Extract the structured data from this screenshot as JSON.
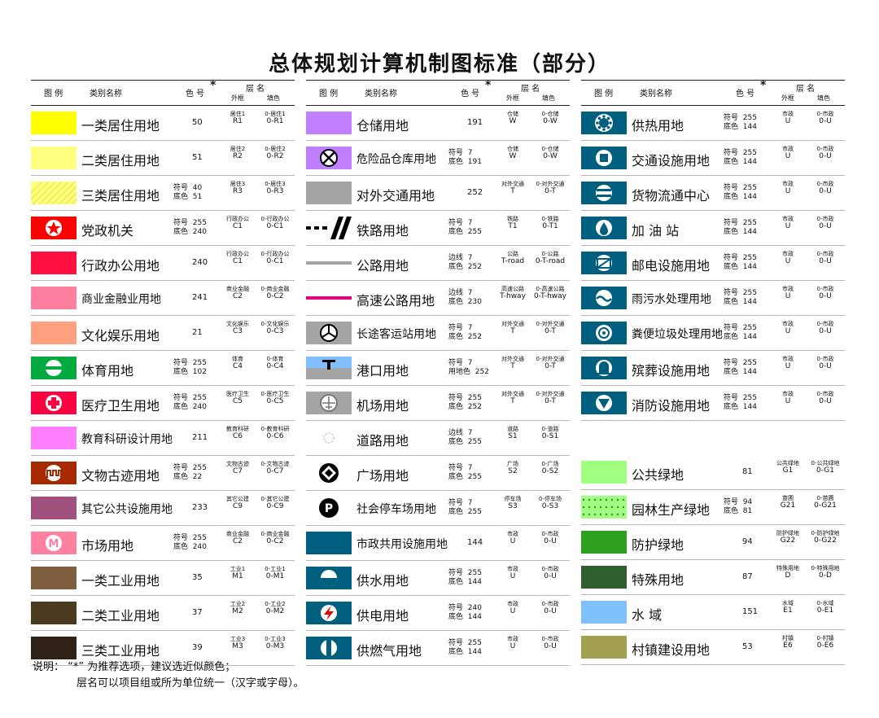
{
  "title": "总体规划计算机制图标准（部分）",
  "header": {
    "legend": "图 例",
    "name": "类别名称",
    "code": "色 号",
    "star": "*",
    "layer": "层 名",
    "outer": "外框",
    "fill": "填色"
  },
  "note": {
    "line1": "说明：  “*” 为推荐选项，建议选近似颜色；",
    "line2": "层名可以项目组或所为单位统一（汉字或字母）。"
  },
  "columns": [
    {
      "rows": [
        {
          "name": "一类居住用地",
          "icon": "yellow-swatch",
          "color": "#ffff00",
          "code_single": "50",
          "outer_cn": "居住1",
          "outer_code": "R1",
          "fill_cn": "0-居住1",
          "fill_code": "0-R1"
        },
        {
          "name": "二类居住用地",
          "icon": "light-yellow-swatch",
          "color": "#ffff80",
          "code_single": "51",
          "outer_cn": "居住2",
          "outer_code": "R2",
          "fill_cn": "0-居住2",
          "fill_code": "0-R2"
        },
        {
          "name": "三类居住用地",
          "icon": "hatched-yellow-swatch",
          "color": "#ffff80",
          "sym_label": "符号",
          "sym_val": "40",
          "base_label": "底色",
          "base_val": "51",
          "outer_cn": "居住3",
          "outer_code": "R3",
          "fill_cn": "0-居住3",
          "fill_code": "0-R3"
        },
        {
          "name": "党政机关",
          "icon": "star-circle-icon",
          "color": "#ff0000",
          "sym_label": "符号",
          "sym_val": "255",
          "base_label": "底色",
          "base_val": "240",
          "outer_cn": "行政办公",
          "outer_code": "C1",
          "fill_cn": "0-行政办公",
          "fill_code": "0-C1"
        },
        {
          "name": "行政办公用地",
          "icon": "red-swatch",
          "color": "#ff1040",
          "code_single": "240",
          "outer_cn": "行政办公",
          "outer_code": "C1",
          "fill_cn": "0-行政办公",
          "fill_code": "0-C1"
        },
        {
          "name": "商业金融业用地",
          "icon": "pink-swatch",
          "color": "#ff7fa0",
          "code_single": "241",
          "outer_cn": "商业金融",
          "outer_code": "C2",
          "fill_cn": "0-商业金融",
          "fill_code": "0-C2"
        },
        {
          "name": "文化娱乐用地",
          "icon": "salmon-swatch",
          "color": "#ffa07f",
          "code_single": "21",
          "outer_cn": "文化娱乐",
          "outer_code": "C3",
          "fill_cn": "0-文化娱乐",
          "fill_code": "0-C3"
        },
        {
          "name": "体育用地",
          "icon": "sports-circle-icon",
          "color": "#00aa3f",
          "sym_label": "符号",
          "sym_val": "255",
          "base_label": "底色",
          "base_val": "102",
          "outer_cn": "体育",
          "outer_code": "C4",
          "fill_cn": "0-体育",
          "fill_code": "0-C4"
        },
        {
          "name": "医疗卫生用地",
          "icon": "medical-cross-icon",
          "color": "#ff0040",
          "sym_label": "符号",
          "sym_val": "255",
          "base_label": "底色",
          "base_val": "240",
          "outer_cn": "医疗卫生",
          "outer_code": "C5",
          "fill_cn": "0-医疗卫生",
          "fill_code": "0-C5"
        },
        {
          "name": "教育科研设计用地",
          "icon": "violet-swatch",
          "color": "#ff80ff",
          "code_single": "211",
          "outer_cn": "教育科研",
          "outer_code": "C6",
          "fill_cn": "0-教育科研",
          "fill_code": "0-C6"
        },
        {
          "name": "文物古迹用地",
          "icon": "heritage-icon",
          "color": "#a52a00",
          "sym_label": "符号",
          "sym_val": "255",
          "base_label": "底色",
          "base_val": "22",
          "outer_cn": "文物古迹",
          "outer_code": "C7",
          "fill_cn": "0-文物古迹",
          "fill_code": "0-C7"
        },
        {
          "name": "其它公共设施用地",
          "icon": "mauve-swatch",
          "color": "#a0507f",
          "code_single": "233",
          "outer_cn": "其它公建",
          "outer_code": "C9",
          "fill_cn": "0-其它公建",
          "fill_code": "0-C9"
        },
        {
          "name": "市场用地",
          "icon": "market-m-icon",
          "color": "#ff80a0",
          "sym_label": "符号",
          "sym_val": "255",
          "base_label": "底色",
          "base_val": "240",
          "outer_cn": "商业金融",
          "outer_code": "C2",
          "fill_cn": "0-商业金融",
          "fill_code": "0-C2"
        },
        {
          "name": "一类工业用地",
          "icon": "brown-swatch",
          "color": "#7f5f3f",
          "code_single": "35",
          "outer_cn": "工业1",
          "outer_code": "M1",
          "fill_cn": "0-工业1",
          "fill_code": "0-M1"
        },
        {
          "name": "二类工业用地",
          "icon": "dark-brown-swatch",
          "color": "#4c3a20",
          "code_single": "37",
          "outer_cn": "工业2",
          "outer_code": "M2",
          "fill_cn": "0-工业2",
          "fill_code": "0-M2"
        },
        {
          "name": "三类工业用地",
          "icon": "darkest-brown-swatch",
          "color": "#2e2218",
          "code_single": "39",
          "outer_cn": "工业3",
          "outer_code": "M3",
          "fill_cn": "0-工业3",
          "fill_code": "0-M3"
        }
      ]
    },
    {
      "rows": [
        {
          "name": "仓储用地",
          "icon": "purple-swatch",
          "color": "#bf7fff",
          "code_single": "191",
          "outer_cn": "仓储",
          "outer_code": "W",
          "fill_cn": "0-仓储",
          "fill_code": "0-W"
        },
        {
          "name": "危险品仓库用地",
          "icon": "hazard-x-icon",
          "color": "#bf7fff",
          "sym_label": "符号",
          "sym_val": "7",
          "base_label": "底色",
          "base_val": "191",
          "outer_cn": "仓储",
          "outer_code": "W",
          "fill_cn": "0-仓储",
          "fill_code": "0-W"
        },
        {
          "name": "对外交通用地",
          "icon": "gray-swatch",
          "color": "#a5a5a5",
          "code_single": "252",
          "outer_cn": "对外交通",
          "outer_code": "T",
          "fill_cn": "0-对外交通",
          "fill_code": "0-T"
        },
        {
          "name": "铁路用地",
          "icon": "railway-icon",
          "color": "#000000",
          "sym_label": "符号",
          "sym_val": "7",
          "base_label": "底色",
          "base_val": "255",
          "outer_cn": "铁路",
          "outer_code": "T1",
          "fill_cn": "0-铁路",
          "fill_code": "0-T1"
        },
        {
          "name": "公路用地",
          "icon": "road-line-icon",
          "color": "#a5a5a5",
          "sym_label": "边线",
          "sym_val": "7",
          "base_label": "底色",
          "base_val": "252",
          "outer_cn": "公路",
          "outer_code": "T-road",
          "fill_cn": "0-公路",
          "fill_code": "0-T-road"
        },
        {
          "name": "高速公路用地",
          "icon": "highway-line-icon",
          "color": "#e0007f",
          "sym_label": "边线",
          "sym_val": "7",
          "base_label": "底色",
          "base_val": "230",
          "outer_cn": "高速公路",
          "outer_code": "T-hway",
          "fill_cn": "0-高速公路",
          "fill_code": "0-T-hway"
        },
        {
          "name": "长途客运站用地",
          "icon": "bus-station-icon",
          "color": "#a5a5a5",
          "sym_label": "符号",
          "sym_val": "7",
          "base_label": "底色",
          "base_val": "252",
          "outer_cn": "对外交通",
          "outer_code": "T",
          "fill_cn": "0-对外交通",
          "fill_code": "0-T"
        },
        {
          "name": "港口用地",
          "icon": "port-anchor-icon",
          "color": "#7fbfff",
          "sym_label": "符号",
          "sym_val": "7",
          "base_label": "用地色",
          "base_val": "252",
          "outer_cn": "对外交通",
          "outer_code": "T",
          "fill_cn": "0-对外交通",
          "fill_code": "0-T"
        },
        {
          "name": "机场用地",
          "icon": "airport-icon",
          "color": "#a5a5a5",
          "sym_label": "符号",
          "sym_val": "255",
          "base_label": "底色",
          "base_val": "252",
          "outer_cn": "对外交通",
          "outer_code": "T",
          "fill_cn": "0-对外交通",
          "fill_code": "0-T"
        },
        {
          "name": "道路用地",
          "icon": "road-dots-icon",
          "color": "#ffffff",
          "sym_label": "边线",
          "sym_val": "7",
          "base_label": "底色",
          "base_val": "255",
          "outer_cn": "道路",
          "outer_code": "S1",
          "fill_cn": "0-道路",
          "fill_code": "0-S1"
        },
        {
          "name": "广场用地",
          "icon": "plaza-diamond-icon",
          "color": "#ffffff",
          "sym_label": "符号",
          "sym_val": "7",
          "base_label": "底色",
          "base_val": "255",
          "outer_cn": "广场",
          "outer_code": "S2",
          "fill_cn": "0-广场",
          "fill_code": "0-S2"
        },
        {
          "name": "社会停车场用地",
          "icon": "parking-p-icon",
          "color": "#ffffff",
          "sym_label": "符号",
          "sym_val": "7",
          "base_label": "底色",
          "base_val": "255",
          "outer_cn": "停车场",
          "outer_code": "S3",
          "fill_cn": "0-停车场",
          "fill_code": "0-S3"
        },
        {
          "name": "市政共用设施用地",
          "icon": "teal-swatch",
          "color": "#005f7f",
          "code_single": "144",
          "outer_cn": "市政",
          "outer_code": "U",
          "fill_cn": "0-市政",
          "fill_code": "0-U"
        },
        {
          "name": "供水用地",
          "icon": "water-supply-icon",
          "color": "#005f7f",
          "sym_label": "符号",
          "sym_val": "255",
          "base_label": "底色",
          "base_val": "144",
          "outer_cn": "市政",
          "outer_code": "U",
          "fill_cn": "0-市政",
          "fill_code": "0-U"
        },
        {
          "name": "供电用地",
          "icon": "power-bolt-icon",
          "color": "#005f7f",
          "sym_label": "符号",
          "sym_val": "240",
          "base_label": "底色",
          "base_val": "144",
          "outer_cn": "市政",
          "outer_code": "U",
          "fill_cn": "0-市政",
          "fill_code": "0-U"
        },
        {
          "name": "供燃气用地",
          "icon": "gas-supply-icon",
          "color": "#005f7f",
          "sym_label": "符号",
          "sym_val": "255",
          "base_label": "底色",
          "base_val": "144",
          "outer_cn": "市政",
          "outer_code": "U",
          "fill_cn": "0-市政",
          "fill_code": "0-U"
        }
      ]
    },
    {
      "rows": [
        {
          "name": "供热用地",
          "icon": "heating-gear-icon",
          "color": "#005f7f",
          "sym_label": "符号",
          "sym_val": "255",
          "base_label": "底色",
          "base_val": "144",
          "outer_cn": "市政",
          "outer_code": "U",
          "fill_cn": "0-市政",
          "fill_code": "0-U"
        },
        {
          "name": "交通设施用地",
          "icon": "transport-square-icon",
          "color": "#005f7f",
          "sym_label": "符号",
          "sym_val": "255",
          "base_label": "底色",
          "base_val": "144",
          "outer_cn": "市政",
          "outer_code": "U",
          "fill_cn": "0-市政",
          "fill_code": "0-U"
        },
        {
          "name": "货物流通中心",
          "icon": "logistics-icon",
          "color": "#005f7f",
          "sym_label": "符号",
          "sym_val": "255",
          "base_label": "底色",
          "base_val": "144",
          "outer_cn": "市政",
          "outer_code": "U",
          "fill_cn": "0-市政",
          "fill_code": "0-U"
        },
        {
          "name": "加 油 站",
          "icon": "fuel-drop-icon",
          "color": "#005f7f",
          "sym_label": "符号",
          "sym_val": "255",
          "base_label": "底色",
          "base_val": "144",
          "outer_cn": "市政",
          "outer_code": "U",
          "fill_cn": "0-市政",
          "fill_code": "0-U"
        },
        {
          "name": "邮电设施用地",
          "icon": "post-envelope-icon",
          "color": "#005f7f",
          "sym_label": "符号",
          "sym_val": "255",
          "base_label": "底色",
          "base_val": "144",
          "outer_cn": "市政",
          "outer_code": "U",
          "fill_cn": "0-市政",
          "fill_code": "0-U"
        },
        {
          "name": "雨污水处理用地",
          "icon": "sewage-icon",
          "color": "#005f7f",
          "sym_label": "符号",
          "sym_val": "255",
          "base_label": "底色",
          "base_val": "144",
          "outer_cn": "市政",
          "outer_code": "U",
          "fill_cn": "0-市政",
          "fill_code": "0-U"
        },
        {
          "name": "粪便垃圾处理用地",
          "icon": "waste-icon",
          "color": "#005f7f",
          "sym_label": "符号",
          "sym_val": "255",
          "base_label": "底色",
          "base_val": "144",
          "outer_cn": "市政",
          "outer_code": "U",
          "fill_cn": "0-市政",
          "fill_code": "0-U"
        },
        {
          "name": "殡葬设施用地",
          "icon": "funeral-icon",
          "color": "#005f7f",
          "sym_label": "符号",
          "sym_val": "255",
          "base_label": "底色",
          "base_val": "144",
          "outer_cn": "市政",
          "outer_code": "U",
          "fill_cn": "0-市政",
          "fill_code": "0-U"
        },
        {
          "name": "消防设施用地",
          "icon": "fire-triangle-icon",
          "color": "#005f7f",
          "sym_label": "符号",
          "sym_val": "255",
          "base_label": "底色",
          "base_val": "144",
          "outer_cn": "市政",
          "outer_code": "U",
          "fill_cn": "0-市政",
          "fill_code": "0-U"
        },
        {
          "empty": true
        },
        {
          "name": "公共绿地",
          "icon": "light-green-swatch",
          "color": "#a0ff80",
          "code_single": "81",
          "outer_cn": "公共绿地",
          "outer_code": "G1",
          "fill_cn": "0-公共绿地",
          "fill_code": "0-G1"
        },
        {
          "name": "园林生产绿地",
          "icon": "dotted-green-swatch",
          "color": "#a0ff80",
          "sym_label": "符号",
          "sym_val": "94",
          "base_label": "底色",
          "base_val": "81",
          "outer_cn": "苗圃",
          "outer_code": "G21",
          "fill_cn": "0-苗圃",
          "fill_code": "0-G21"
        },
        {
          "name": "防护绿地",
          "icon": "green-swatch",
          "color": "#2e9f1e",
          "code_single": "94",
          "outer_cn": "防护绿地",
          "outer_code": "G22",
          "fill_cn": "0-防护绿地",
          "fill_code": "0-G22"
        },
        {
          "name": "特殊用地",
          "icon": "dark-green-swatch",
          "color": "#2f5f30",
          "code_single": "87",
          "outer_cn": "特殊用地",
          "outer_code": "D",
          "fill_cn": "0-特殊用地",
          "fill_code": "0-D"
        },
        {
          "name": "水    域",
          "icon": "water-blue-swatch",
          "color": "#80c0ff",
          "code_single": "151",
          "outer_cn": "水域",
          "outer_code": "E1",
          "fill_cn": "0-水域",
          "fill_code": "0-E1"
        },
        {
          "name": "村镇建设用地",
          "icon": "olive-swatch",
          "color": "#a0a050",
          "code_single": "53",
          "outer_cn": "村镇",
          "outer_code": "E6",
          "fill_cn": "0-村镇",
          "fill_code": "0-E6"
        }
      ]
    }
  ]
}
